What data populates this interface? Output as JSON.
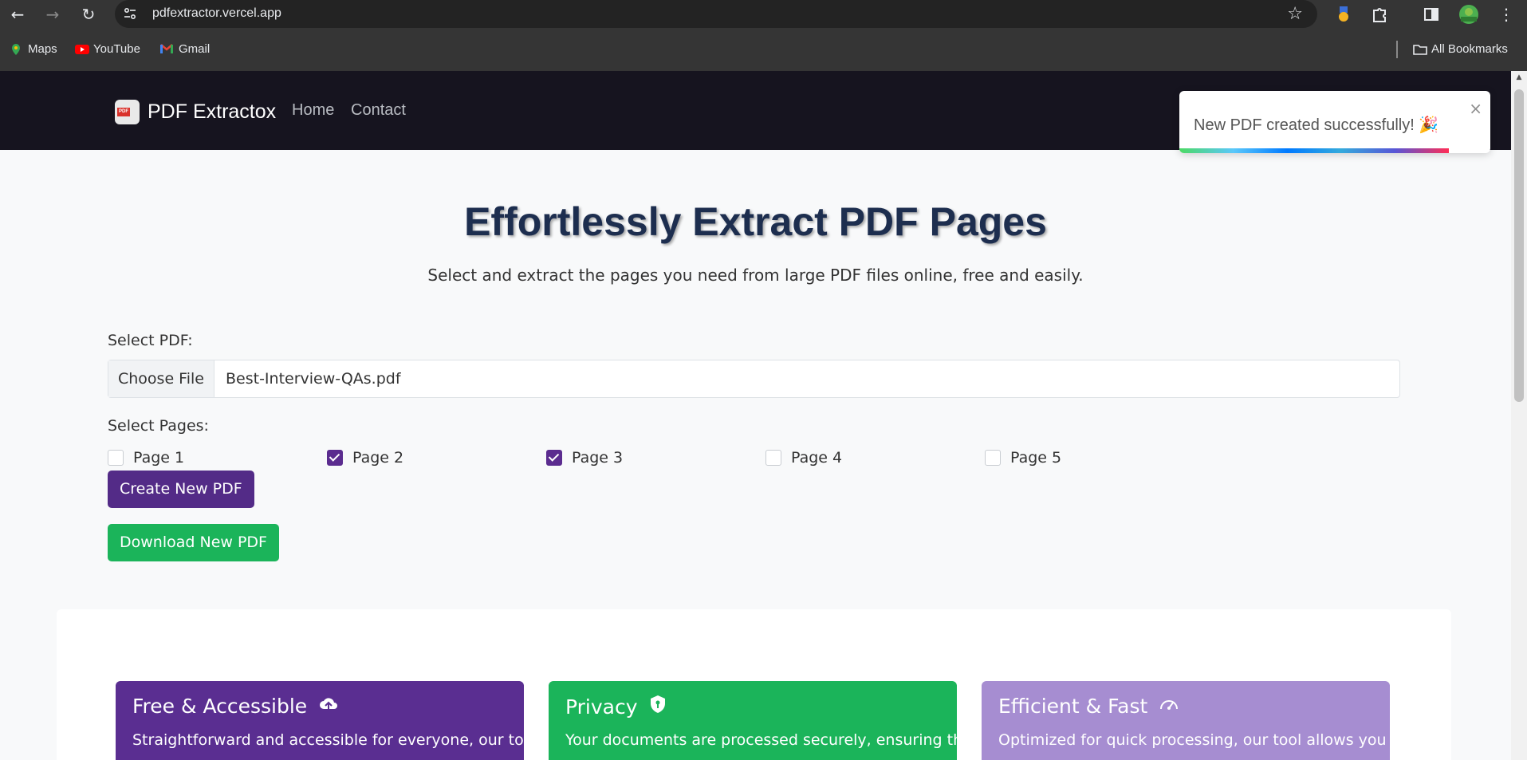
{
  "browser": {
    "url": "pdfextractor.vercel.app",
    "bookmarks": [
      {
        "label": "Maps",
        "icon": "maps-icon"
      },
      {
        "label": "YouTube",
        "icon": "youtube-icon"
      },
      {
        "label": "Gmail",
        "icon": "gmail-icon"
      }
    ],
    "all_bookmarks": "All Bookmarks"
  },
  "navbar": {
    "brand": "PDF Extractox",
    "links": [
      "Home",
      "Contact"
    ]
  },
  "toast": {
    "message": "New PDF created successfully! 🎉",
    "close": "×"
  },
  "hero": {
    "title": "Effortlessly Extract PDF Pages",
    "subtitle": "Select and extract the pages you need from large PDF files online, free and easily."
  },
  "form": {
    "select_pdf_label": "Select PDF:",
    "choose_file": "Choose File",
    "file_name": "Best-Interview-QAs.pdf",
    "select_pages_label": "Select Pages:",
    "pages": [
      {
        "label": "Page 1",
        "checked": false
      },
      {
        "label": "Page 2",
        "checked": true
      },
      {
        "label": "Page 3",
        "checked": true
      },
      {
        "label": "Page 4",
        "checked": false
      },
      {
        "label": "Page 5",
        "checked": false
      }
    ],
    "create_button": "Create New PDF",
    "download_button": "Download New PDF"
  },
  "features": [
    {
      "title": "Free & Accessible",
      "icon": "cloud-upload-icon",
      "text": "Straightforward and accessible for everyone, our tool",
      "color": "#5a2e91"
    },
    {
      "title": "Privacy",
      "icon": "shield-icon",
      "text": "Your documents are processed securely, ensuring the",
      "color": "#1bb45a"
    },
    {
      "title": "Efficient & Fast",
      "icon": "speedometer-icon",
      "text": "Optimized for quick processing, our tool allows you",
      "color": "#a68dd1"
    }
  ]
}
